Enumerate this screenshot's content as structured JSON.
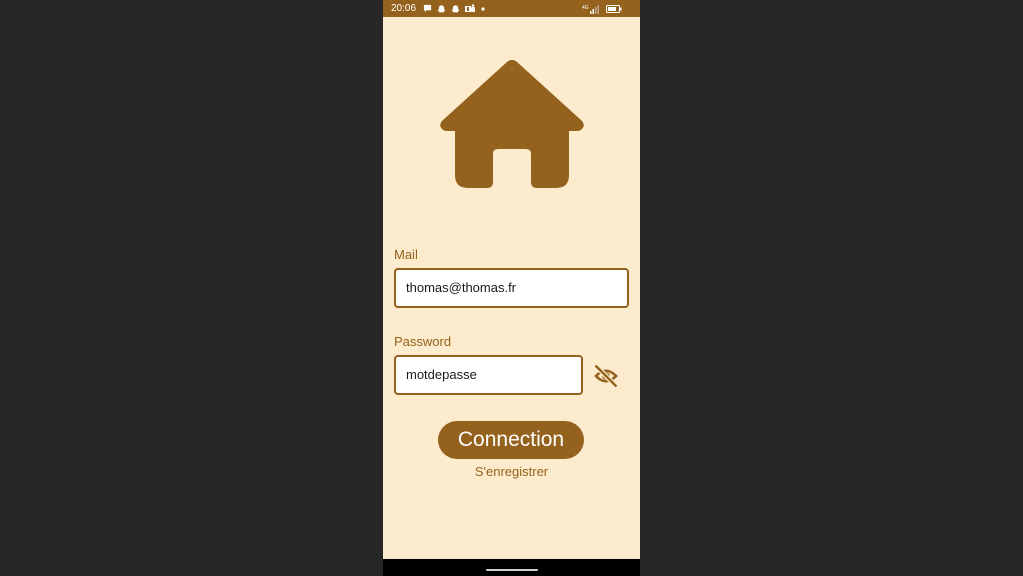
{
  "status_bar": {
    "time": "20:06",
    "notification_icons": [
      "chat-bubble-icon",
      "snapchat-ghost-icon",
      "snapchat-ghost-icon",
      "teams-icon",
      "dot-icon"
    ],
    "network_label": "4G",
    "battery_icon": "battery-icon"
  },
  "logo": {
    "icon": "home-icon",
    "color": "#94621c"
  },
  "form": {
    "mail_label": "Mail",
    "mail_value": "thomas@thomas.fr",
    "password_label": "Password",
    "password_value": "motdepasse",
    "visibility_icon": "visibility-off-icon"
  },
  "actions": {
    "connection_label": "Connection",
    "register_label": "S'enregistrer"
  },
  "colors": {
    "primary": "#94621c",
    "background": "#fdebcd",
    "outer_background": "#262626"
  }
}
